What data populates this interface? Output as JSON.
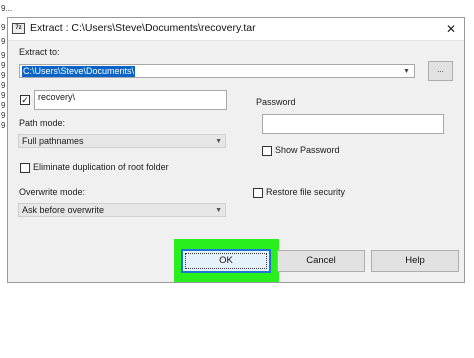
{
  "background": {
    "fragments": [
      "9...",
      "9",
      "9",
      "9",
      "9",
      "9",
      "9",
      "9",
      "9",
      "9",
      "9",
      "9",
      "9"
    ]
  },
  "dialog": {
    "title": "Extract : C:\\Users\\Steve\\Documents\\recovery.tar",
    "close_glyph": "✕",
    "app_icon_text": "7z"
  },
  "extract_to": {
    "label": "Extract to:",
    "value": "C:\\Users\\Steve\\Documents\\",
    "browse_label": "..."
  },
  "subfolder": {
    "checked": true,
    "value": "recovery\\"
  },
  "path_mode": {
    "label": "Path mode:",
    "value": "Full pathnames"
  },
  "eliminate_duplication": {
    "label": "Eliminate duplication of root folder",
    "checked": false
  },
  "overwrite_mode": {
    "label": "Overwrite mode:",
    "value": "Ask before overwrite"
  },
  "password": {
    "label": "Password",
    "value": "",
    "show_label": "Show Password",
    "show_checked": false
  },
  "restore_security": {
    "label": "Restore file security",
    "checked": false
  },
  "buttons": {
    "ok": "OK",
    "cancel": "Cancel",
    "help": "Help"
  },
  "colors": {
    "highlight": "#29f01d",
    "selection": "#0a64c8",
    "ok_border": "#1a76d2"
  }
}
